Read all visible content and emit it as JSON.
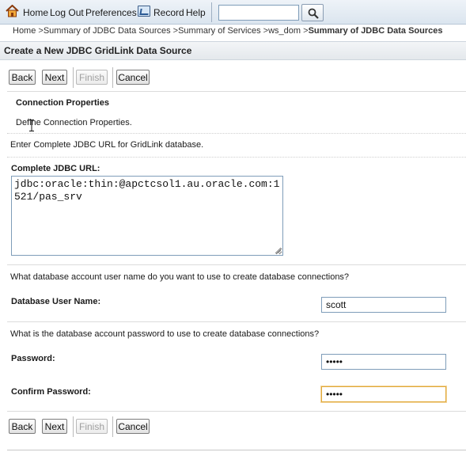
{
  "toolbar": {
    "home": "Home",
    "logout": "Log Out",
    "preferences": "Preferences",
    "record": "Record",
    "help": "Help",
    "search_value": "",
    "icons": {
      "home": "home-icon",
      "record": "record-icon",
      "search": "search-icon"
    }
  },
  "breadcrumb": {
    "items": [
      "Home",
      "Summary of JDBC Data Sources",
      "Summary of Services",
      "ws_dom"
    ],
    "separator": " >",
    "current": "Summary of JDBC Data Sources"
  },
  "page": {
    "title": "Create a New JDBC GridLink Data Source"
  },
  "buttons": {
    "back": "Back",
    "next": "Next",
    "finish": "Finish",
    "cancel": "Cancel"
  },
  "connection": {
    "heading": "Connection Properties",
    "description": "Define Connection Properties.",
    "url_prompt": "Enter Complete JDBC URL for GridLink database.",
    "url_label": "Complete JDBC URL:",
    "url_value": "jdbc:oracle:thin:@apctcsol1.au.oracle.com:1521/pas_srv"
  },
  "user": {
    "prompt": "What database account user name do you want to use to create database connections?",
    "label": "Database User Name:",
    "value": "scott"
  },
  "password": {
    "prompt": "What is the database account password to use to create database connections?",
    "label": "Password:",
    "value_masked": "•••••",
    "confirm_label": "Confirm Password:",
    "confirm_value_masked": "•••••"
  },
  "colors": {
    "toolbar_bg": "#dbe5ef",
    "focus_border": "#e0a93a",
    "input_border": "#7f9db9",
    "disabled_text": "#a0a0a0"
  }
}
